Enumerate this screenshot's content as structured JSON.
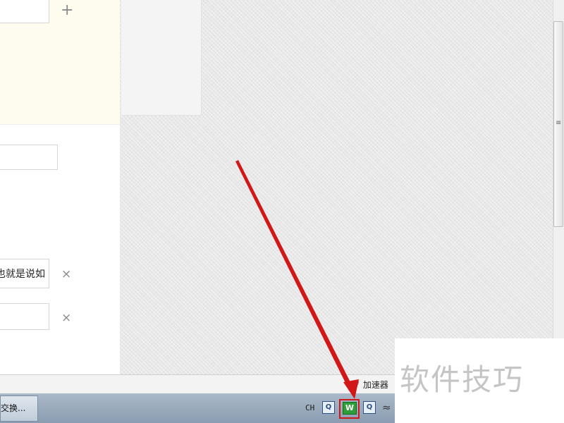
{
  "form": {
    "input1_text": "也就是说如",
    "add_symbol": "+",
    "remove_symbol": "×"
  },
  "status_bar": {
    "accelerator_label": "加速器",
    "accelerator_icon": "rocket-icon"
  },
  "taskbar": {
    "task_button_label": "交换...",
    "language_indicator": "CH",
    "tray_q_glyph": "Q",
    "tray_w_glyph": "W"
  },
  "watermark": {
    "text": "软件技巧"
  },
  "scrollbar": {
    "grip": "≡"
  },
  "colors": {
    "annotation_arrow": "#d01818",
    "highlight_box": "#d01818",
    "tray_w_icon": "#2f9e3a"
  }
}
